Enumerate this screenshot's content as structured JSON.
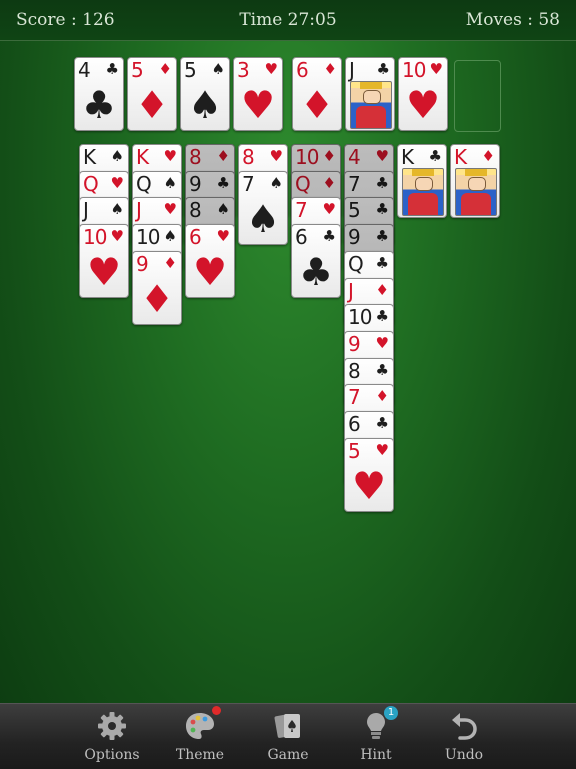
{
  "header": {
    "score_label": "Score : 126",
    "time_label": "Time 27:05",
    "moves_label": "Moves : 58"
  },
  "colors": {
    "felt": "#1f6d22",
    "red_suit": "#d3142a",
    "black_suit": "#1e1e1e",
    "toolbar": "#2b2b2b",
    "toolbar_text": "#bfbfbf"
  },
  "foundations": [
    {
      "rank": "4",
      "suit": "clubs"
    },
    {
      "rank": "5",
      "suit": "diamonds"
    },
    {
      "rank": "5",
      "suit": "spades"
    },
    {
      "rank": "3",
      "suit": "hearts"
    },
    {
      "rank": "6",
      "suit": "diamonds"
    },
    {
      "rank": "J",
      "suit": "clubs"
    },
    {
      "rank": "10",
      "suit": "hearts"
    },
    {
      "rank": "",
      "suit": "empty"
    }
  ],
  "tableau": [
    [
      {
        "rank": "K",
        "suit": "spades"
      },
      {
        "rank": "Q",
        "suit": "hearts"
      },
      {
        "rank": "J",
        "suit": "spades"
      },
      {
        "rank": "10",
        "suit": "hearts"
      }
    ],
    [
      {
        "rank": "K",
        "suit": "hearts"
      },
      {
        "rank": "Q",
        "suit": "spades"
      },
      {
        "rank": "J",
        "suit": "hearts"
      },
      {
        "rank": "10",
        "suit": "spades"
      },
      {
        "rank": "9",
        "suit": "diamonds"
      }
    ],
    [
      {
        "rank": "8",
        "suit": "diamonds",
        "dim": true
      },
      {
        "rank": "9",
        "suit": "clubs",
        "dim": true
      },
      {
        "rank": "8",
        "suit": "spades",
        "dim": true
      },
      {
        "rank": "6",
        "suit": "hearts"
      }
    ],
    [
      {
        "rank": "8",
        "suit": "hearts"
      },
      {
        "rank": "7",
        "suit": "spades"
      }
    ],
    [
      {
        "rank": "10",
        "suit": "diamonds",
        "dim": true
      },
      {
        "rank": "Q",
        "suit": "diamonds",
        "dim": true
      },
      {
        "rank": "7",
        "suit": "hearts"
      },
      {
        "rank": "6",
        "suit": "clubs"
      }
    ],
    [
      {
        "rank": "4",
        "suit": "hearts",
        "dim": true
      },
      {
        "rank": "7",
        "suit": "clubs",
        "dim": true
      },
      {
        "rank": "5",
        "suit": "clubs",
        "dim": true
      },
      {
        "rank": "9",
        "suit": "clubs",
        "dim": true
      },
      {
        "rank": "Q",
        "suit": "clubs"
      },
      {
        "rank": "J",
        "suit": "diamonds"
      },
      {
        "rank": "10",
        "suit": "clubs"
      },
      {
        "rank": "9",
        "suit": "hearts"
      },
      {
        "rank": "8",
        "suit": "clubs"
      },
      {
        "rank": "7",
        "suit": "diamonds"
      },
      {
        "rank": "6",
        "suit": "clubs"
      },
      {
        "rank": "5",
        "suit": "hearts"
      }
    ],
    [
      {
        "rank": "K",
        "suit": "clubs"
      }
    ],
    [
      {
        "rank": "K",
        "suit": "diamonds"
      }
    ]
  ],
  "toolbar": {
    "options_label": "Options",
    "theme_label": "Theme",
    "game_label": "Game",
    "hint_label": "Hint",
    "undo_label": "Undo",
    "hint_count": "1"
  }
}
